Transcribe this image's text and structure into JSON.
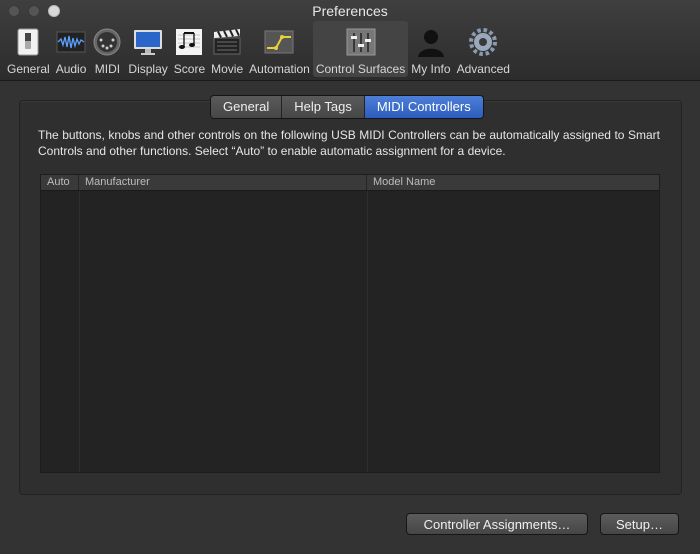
{
  "window": {
    "title": "Preferences"
  },
  "toolbar": {
    "items": [
      {
        "label": "General",
        "icon": "switch-icon"
      },
      {
        "label": "Audio",
        "icon": "waveform-icon"
      },
      {
        "label": "MIDI",
        "icon": "midi-connector-icon"
      },
      {
        "label": "Display",
        "icon": "monitor-icon"
      },
      {
        "label": "Score",
        "icon": "sheet-music-icon"
      },
      {
        "label": "Movie",
        "icon": "clapperboard-icon"
      },
      {
        "label": "Automation",
        "icon": "automation-curve-icon"
      },
      {
        "label": "Control Surfaces",
        "icon": "faders-icon",
        "selected": true
      },
      {
        "label": "My Info",
        "icon": "person-icon"
      },
      {
        "label": "Advanced",
        "icon": "gear-icon"
      }
    ]
  },
  "tabs": {
    "items": [
      "General",
      "Help Tags",
      "MIDI Controllers"
    ],
    "selected": "MIDI Controllers"
  },
  "description": "The buttons, knobs and other controls on the following USB MIDI Controllers can be automatically assigned to Smart Controls and other functions. Select “Auto” to enable automatic assignment for a device.",
  "table": {
    "columns": [
      "Auto",
      "Manufacturer",
      "Model Name"
    ],
    "rows": []
  },
  "buttons": {
    "controller_assignments": "Controller Assignments…",
    "setup": "Setup…"
  },
  "colors": {
    "accent": "#3d6fd1",
    "background": "#2e2e2e"
  }
}
